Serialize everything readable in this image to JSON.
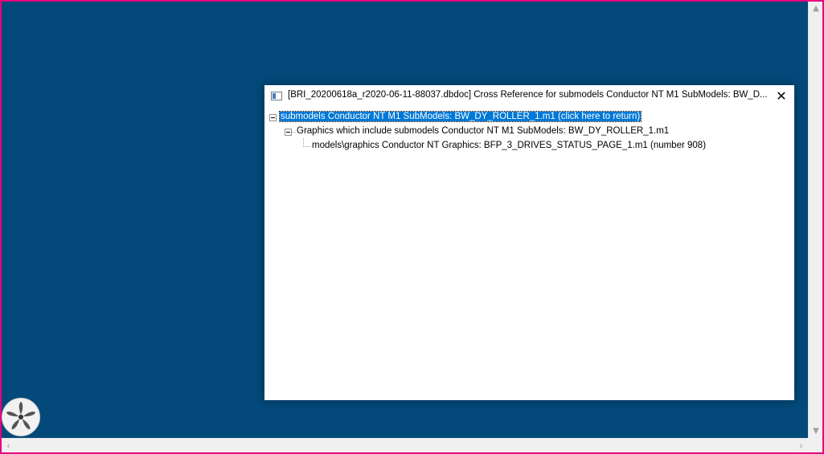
{
  "window": {
    "title": "[BRI_20200618a_r2020-06-11-88037.dbdoc] Cross Reference for submodels Conductor NT M1 SubModels: BW_D...",
    "close_glyph": "✕"
  },
  "tree": {
    "root": {
      "label": "submodels Conductor NT M1 SubModels: BW_DY_ROLLER_1.m1 (click here to return)"
    },
    "child": {
      "label": "Graphics which include submodels Conductor NT M1 SubModels: BW_DY_ROLLER_1.m1"
    },
    "leaf": {
      "label": "models\\graphics Conductor NT Graphics: BFP_3_DRIVES_STATUS_PAGE_1.m1 (number 908)"
    }
  },
  "scrollbars": {
    "up": "▲",
    "down": "▼",
    "left": "‹",
    "right": "›"
  },
  "colors": {
    "desktop": "#03497a",
    "selection": "#0078d7",
    "frame": "#e6007e"
  },
  "icons": {
    "window": "window-app-icon",
    "close": "close-icon",
    "launcher": "fan-icon"
  }
}
